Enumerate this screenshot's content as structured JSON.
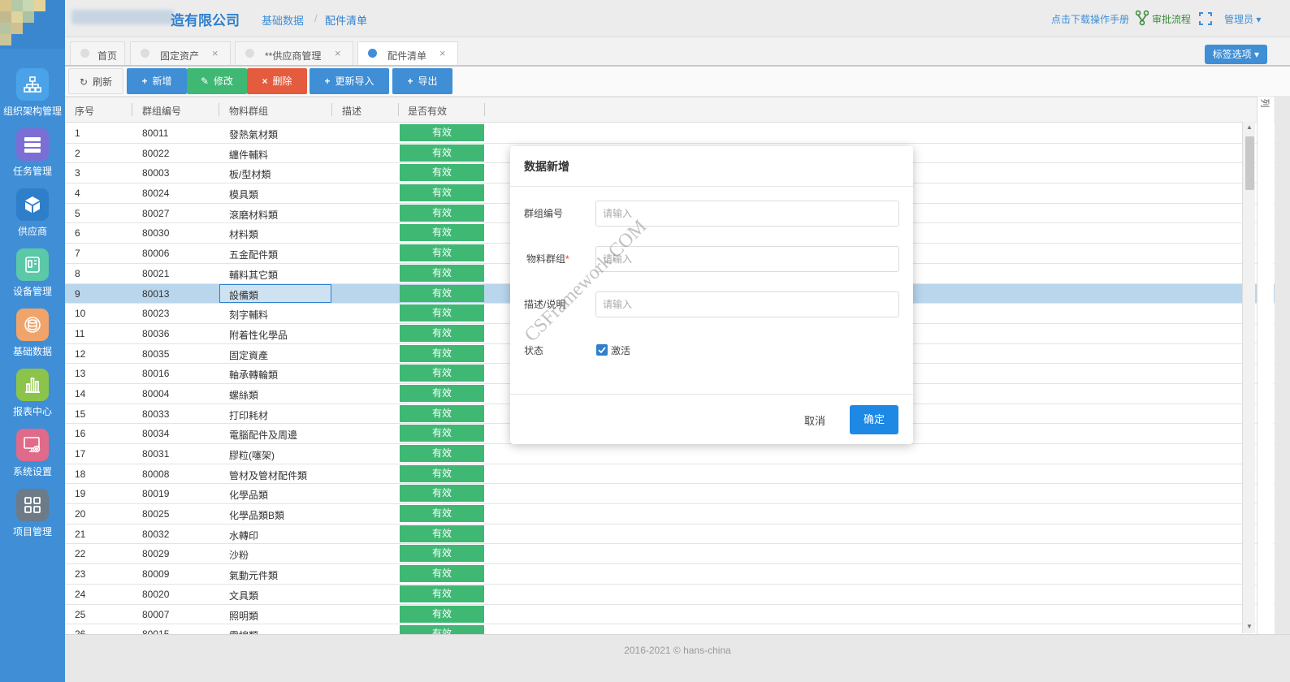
{
  "colors": {
    "primary": "#3f8ed6",
    "add": "#3f8ed6",
    "edit": "#3fb874",
    "delete": "#e45b3d",
    "status_valid": "#3fb874",
    "selected_row": "#b9d6ec"
  },
  "header": {
    "company": "造有限公司",
    "breadcrumb": [
      "基础数据",
      "配件清单"
    ],
    "manual_link": "点击下载操作手册",
    "workflow": "审批流程",
    "user": "管理员"
  },
  "sidebar": {
    "items": [
      {
        "label": "组织架构管理",
        "icon": "org-chart-icon",
        "color": "#4aa3e8"
      },
      {
        "label": "任务管理",
        "icon": "task-list-icon",
        "color": "#7b6fd6"
      },
      {
        "label": "供应商",
        "icon": "cube-icon",
        "color": "#2e7ec9"
      },
      {
        "label": "设备管理",
        "icon": "device-icon",
        "color": "#5bc8a8"
      },
      {
        "label": "基础数据",
        "icon": "database-icon",
        "color": "#f0a46a"
      },
      {
        "label": "报表中心",
        "icon": "bar-chart-icon",
        "color": "#8cc34a"
      },
      {
        "label": "系统设置",
        "icon": "settings-icon",
        "color": "#e06a8a"
      },
      {
        "label": "项目管理",
        "icon": "grid-icon",
        "color": "#6d7b88"
      }
    ]
  },
  "tabs": [
    {
      "label": "首页",
      "closable": false,
      "active": false
    },
    {
      "label": "固定资产",
      "closable": true,
      "active": false
    },
    {
      "label": "**供应商管理",
      "closable": true,
      "active": false
    },
    {
      "label": "配件清单",
      "closable": true,
      "active": true
    }
  ],
  "tag_options": "标签选项",
  "toolbar": {
    "refresh": "刷新",
    "add": "新增",
    "edit": "修改",
    "delete": "删除",
    "update_import": "更新导入",
    "export": "导出"
  },
  "table": {
    "columns": [
      "序号",
      "群组编号",
      "物料群组",
      "描述",
      "是否有效"
    ],
    "rows": [
      {
        "no": "1",
        "code": "80011",
        "group": "發熱氣材類",
        "desc": "",
        "status": "有效"
      },
      {
        "no": "2",
        "code": "80022",
        "group": "纏件輔料",
        "desc": "",
        "status": "有效"
      },
      {
        "no": "3",
        "code": "80003",
        "group": "板/型材類",
        "desc": "",
        "status": "有效"
      },
      {
        "no": "4",
        "code": "80024",
        "group": "模具類",
        "desc": "",
        "status": "有效"
      },
      {
        "no": "5",
        "code": "80027",
        "group": "滾磨材料類",
        "desc": "",
        "status": "有效"
      },
      {
        "no": "6",
        "code": "80030",
        "group": "材料類",
        "desc": "",
        "status": "有效"
      },
      {
        "no": "7",
        "code": "80006",
        "group": "五金配件類",
        "desc": "",
        "status": "有效"
      },
      {
        "no": "8",
        "code": "80021",
        "group": "輔料其它類",
        "desc": "",
        "status": "有效"
      },
      {
        "no": "9",
        "code": "80013",
        "group": "設備類",
        "desc": "",
        "status": "有效"
      },
      {
        "no": "10",
        "code": "80023",
        "group": "刻字輔料",
        "desc": "",
        "status": "有效"
      },
      {
        "no": "11",
        "code": "80036",
        "group": "附着性化學品",
        "desc": "",
        "status": "有效"
      },
      {
        "no": "12",
        "code": "80035",
        "group": "固定資產",
        "desc": "",
        "status": "有效"
      },
      {
        "no": "13",
        "code": "80016",
        "group": "軸承轉輪類",
        "desc": "",
        "status": "有效"
      },
      {
        "no": "14",
        "code": "80004",
        "group": "螺絲類",
        "desc": "",
        "status": "有效"
      },
      {
        "no": "15",
        "code": "80033",
        "group": "打印耗材",
        "desc": "",
        "status": "有效"
      },
      {
        "no": "16",
        "code": "80034",
        "group": "電腦配件及周邊",
        "desc": "",
        "status": "有效"
      },
      {
        "no": "17",
        "code": "80031",
        "group": "膠粒(噻架)",
        "desc": "",
        "status": "有效"
      },
      {
        "no": "18",
        "code": "80008",
        "group": "管材及管材配件類",
        "desc": "",
        "status": "有效"
      },
      {
        "no": "19",
        "code": "80019",
        "group": "化學品類",
        "desc": "",
        "status": "有效"
      },
      {
        "no": "20",
        "code": "80025",
        "group": "化學品類B類",
        "desc": "",
        "status": "有效"
      },
      {
        "no": "21",
        "code": "80032",
        "group": "水轉印",
        "desc": "",
        "status": "有效"
      },
      {
        "no": "22",
        "code": "80029",
        "group": "沙粉",
        "desc": "",
        "status": "有效"
      },
      {
        "no": "23",
        "code": "80009",
        "group": "氣動元件類",
        "desc": "",
        "status": "有效"
      },
      {
        "no": "24",
        "code": "80020",
        "group": "文具類",
        "desc": "",
        "status": "有效"
      },
      {
        "no": "25",
        "code": "80007",
        "group": "照明類",
        "desc": "",
        "status": "有效"
      },
      {
        "no": "26",
        "code": "80015",
        "group": "電線類",
        "desc": "",
        "status": "有效"
      }
    ],
    "selected_row": 9
  },
  "dialog": {
    "title": "数据新增",
    "fields": [
      {
        "label": "群组编号",
        "required": false,
        "placeholder": "请输入",
        "value": ""
      },
      {
        "label": "物料群组",
        "required": true,
        "placeholder": "请输入",
        "value": ""
      },
      {
        "label": "描述/说明",
        "required": false,
        "placeholder": "请输入",
        "value": ""
      }
    ],
    "status_label": "状态",
    "status_checkbox": "激活",
    "status_checked": true,
    "cancel": "取消",
    "confirm": "确定"
  },
  "watermark": "CSFramework.COM",
  "footer": "2016-2021 © hans-china",
  "column_panel_label": "列"
}
